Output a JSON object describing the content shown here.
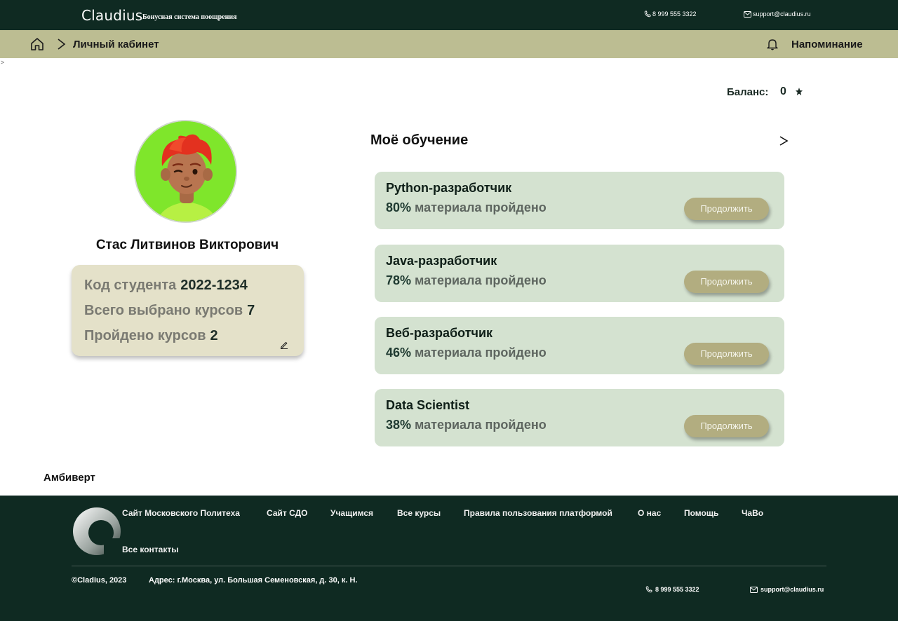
{
  "header": {
    "brand": "Claudius",
    "brand_subtitle": "Бонусная система поощрения",
    "phone": "8 999 555 3322",
    "email": "support@claudius.ru"
  },
  "breadcrumb": {
    "current": "Личный кабинет",
    "reminder": "Напоминание"
  },
  "stray_text": ">",
  "balance": {
    "label": "Баланс:",
    "value": "0"
  },
  "profile": {
    "name": "Стас Литвинов Викторович",
    "student_code_label": "Код студента",
    "student_code": "2022-1234",
    "total_courses_label": "Всего выбрано курсов",
    "total_courses": "7",
    "completed_label": "Пройдено курсов",
    "completed": "2"
  },
  "learning": {
    "title": "Моё обучение",
    "more": ">",
    "continue_label": "Продолжить",
    "progress_suffix": "материала пройдено",
    "courses": [
      {
        "name": "Python-разработчик",
        "percent": "80%"
      },
      {
        "name": "Java-разработчик",
        "percent": "78%"
      },
      {
        "name": "Веб-разработчик",
        "percent": "46%"
      },
      {
        "name": "Data Scientist",
        "percent": "38%"
      }
    ]
  },
  "personality": "Амбиверт",
  "footer": {
    "links": [
      "Сайт Московского Политеха",
      "Сайт СДО",
      "Учащимся",
      "Все курсы",
      "Правила пользования платформой",
      "О нас",
      "Помощь",
      "ЧаВо",
      "Все контакты"
    ],
    "copyright": "©Cladius, 2023",
    "address": "Адрес: г.Москва, ул. Большая Семеновская, д. 30, к. Н.",
    "phone": "8 999 555 3322",
    "email": "support@claudius.ru"
  },
  "colors": {
    "dark": "#0f2a22",
    "olive": "#bcbd92",
    "card": "#d4e2d0",
    "button": "#b2ad80"
  }
}
